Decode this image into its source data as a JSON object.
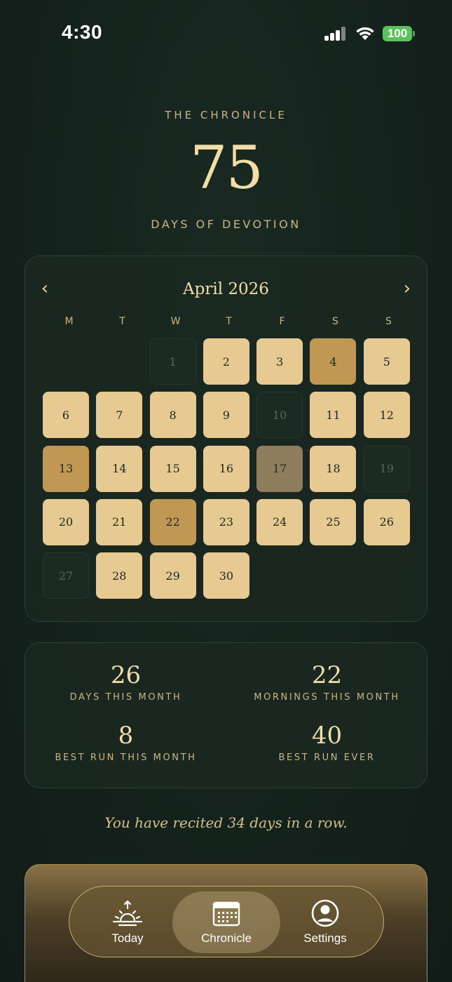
{
  "status_bar": {
    "time": "4:30",
    "battery": "100"
  },
  "header": {
    "eyebrow": "THE CHRONICLE",
    "total_days": "75",
    "subtitle": "DAYS OF DEVOTION"
  },
  "calendar": {
    "month_label": "April 2026",
    "prev_icon": "chevron-left-icon",
    "next_icon": "chevron-right-icon",
    "weekdays": [
      "M",
      "T",
      "W",
      "T",
      "F",
      "S",
      "S"
    ],
    "leading_blanks": 2,
    "days": [
      {
        "n": "1",
        "state": "missed"
      },
      {
        "n": "2",
        "state": "done"
      },
      {
        "n": "3",
        "state": "done"
      },
      {
        "n": "4",
        "state": "gold"
      },
      {
        "n": "5",
        "state": "done"
      },
      {
        "n": "6",
        "state": "done"
      },
      {
        "n": "7",
        "state": "done"
      },
      {
        "n": "8",
        "state": "done"
      },
      {
        "n": "9",
        "state": "done"
      },
      {
        "n": "10",
        "state": "missed"
      },
      {
        "n": "11",
        "state": "done"
      },
      {
        "n": "12",
        "state": "done"
      },
      {
        "n": "13",
        "state": "gold"
      },
      {
        "n": "14",
        "state": "done"
      },
      {
        "n": "15",
        "state": "done"
      },
      {
        "n": "16",
        "state": "done"
      },
      {
        "n": "17",
        "state": "olive"
      },
      {
        "n": "18",
        "state": "done"
      },
      {
        "n": "19",
        "state": "missed"
      },
      {
        "n": "20",
        "state": "done"
      },
      {
        "n": "21",
        "state": "done"
      },
      {
        "n": "22",
        "state": "gold"
      },
      {
        "n": "23",
        "state": "done"
      },
      {
        "n": "24",
        "state": "done"
      },
      {
        "n": "25",
        "state": "done"
      },
      {
        "n": "26",
        "state": "done"
      },
      {
        "n": "27",
        "state": "missed"
      },
      {
        "n": "28",
        "state": "done"
      },
      {
        "n": "29",
        "state": "done"
      },
      {
        "n": "30",
        "state": "done"
      }
    ]
  },
  "stats": {
    "days_this_month": {
      "value": "26",
      "label": "DAYS THIS MONTH"
    },
    "mornings_this_month": {
      "value": "22",
      "label": "MORNINGS THIS MONTH"
    },
    "best_run_month": {
      "value": "8",
      "label": "BEST RUN THIS MONTH"
    },
    "best_run_ever": {
      "value": "40",
      "label": "BEST RUN EVER"
    }
  },
  "streak_text": "You have recited 34 days in a row.",
  "tabs": [
    {
      "label": "Today",
      "icon": "sunrise-icon",
      "active": false
    },
    {
      "label": "Chronicle",
      "icon": "calendar-icon",
      "active": true
    },
    {
      "label": "Settings",
      "icon": "profile-icon",
      "active": false
    }
  ],
  "colors": {
    "background": "#14211c",
    "accent_gold": "#f0dea6",
    "day_done": "#e6ca92",
    "day_gold": "#c19853",
    "day_olive": "#8e7e5e",
    "battery": "#5ac35a"
  }
}
